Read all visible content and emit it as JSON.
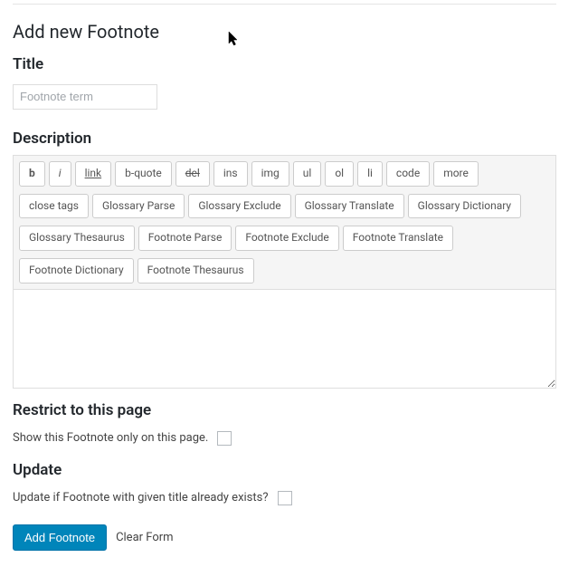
{
  "page": {
    "title": "Add new Footnote"
  },
  "title_section": {
    "heading": "Title",
    "placeholder": "Footnote term",
    "value": ""
  },
  "description_section": {
    "heading": "Description",
    "toolbar": [
      {
        "key": "b",
        "label": "b",
        "style": "bold"
      },
      {
        "key": "i",
        "label": "i",
        "style": "italic"
      },
      {
        "key": "link",
        "label": "link",
        "style": "underline"
      },
      {
        "key": "b-quote",
        "label": "b-quote",
        "style": ""
      },
      {
        "key": "del",
        "label": "del",
        "style": "strike"
      },
      {
        "key": "ins",
        "label": "ins",
        "style": ""
      },
      {
        "key": "img",
        "label": "img",
        "style": ""
      },
      {
        "key": "ul",
        "label": "ul",
        "style": ""
      },
      {
        "key": "ol",
        "label": "ol",
        "style": ""
      },
      {
        "key": "li",
        "label": "li",
        "style": ""
      },
      {
        "key": "code",
        "label": "code",
        "style": ""
      },
      {
        "key": "more",
        "label": "more",
        "style": ""
      },
      {
        "key": "close-tags",
        "label": "close tags",
        "style": ""
      },
      {
        "key": "glossary-parse",
        "label": "Glossary Parse",
        "style": ""
      },
      {
        "key": "glossary-exclude",
        "label": "Glossary Exclude",
        "style": ""
      },
      {
        "key": "glossary-translate",
        "label": "Glossary Translate",
        "style": ""
      },
      {
        "key": "glossary-dictionary",
        "label": "Glossary Dictionary",
        "style": ""
      },
      {
        "key": "glossary-thesaurus",
        "label": "Glossary Thesaurus",
        "style": ""
      },
      {
        "key": "footnote-parse",
        "label": "Footnote Parse",
        "style": ""
      },
      {
        "key": "footnote-exclude",
        "label": "Footnote Exclude",
        "style": ""
      },
      {
        "key": "footnote-translate",
        "label": "Footnote Translate",
        "style": ""
      },
      {
        "key": "footnote-dictionary",
        "label": "Footnote Dictionary",
        "style": ""
      },
      {
        "key": "footnote-thesaurus",
        "label": "Footnote Thesaurus",
        "style": ""
      }
    ],
    "content": ""
  },
  "restrict_section": {
    "heading": "Restrict to this page",
    "label": "Show this Footnote only on this page.",
    "checked": false
  },
  "update_section": {
    "heading": "Update",
    "label": "Update if Footnote with given title already exists?",
    "checked": false
  },
  "actions": {
    "submit_label": "Add Footnote",
    "clear_label": "Clear Form"
  }
}
